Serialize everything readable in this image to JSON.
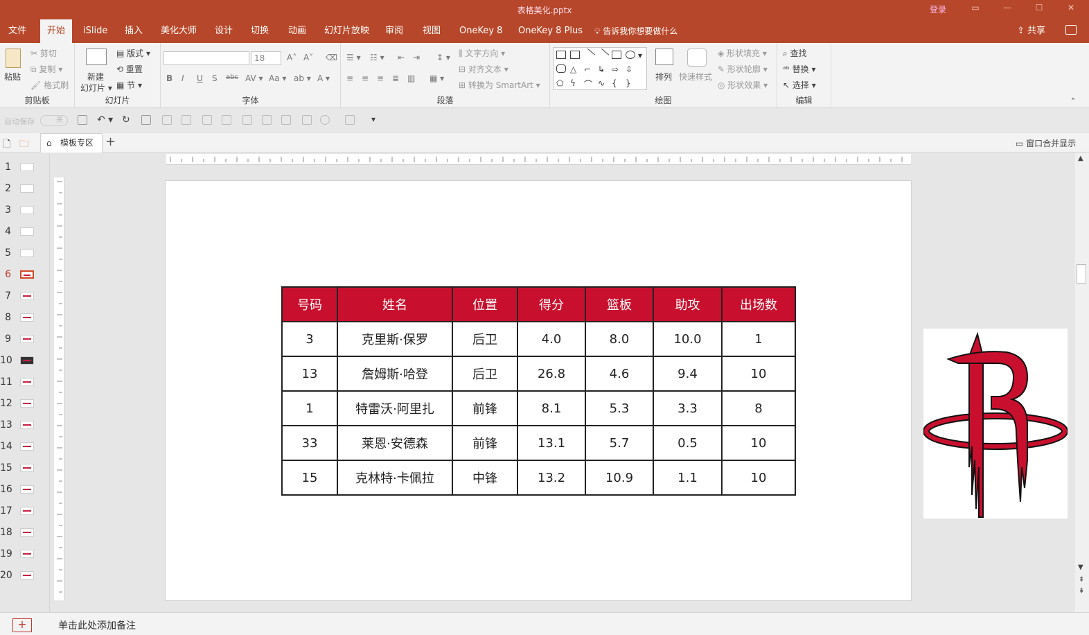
{
  "window": {
    "title": "表格美化.pptx",
    "login_label": "登录"
  },
  "menu": {
    "tabs": [
      "文件",
      "开始",
      "iSlide",
      "插入",
      "美化大师",
      "设计",
      "切换",
      "动画",
      "幻灯片放映",
      "审阅",
      "视图",
      "OneKey 8",
      "OneKey 8 Plus"
    ],
    "active_tab": "开始",
    "tell_me": "告诉我你想要做什么",
    "share": "共享"
  },
  "ribbon": {
    "clipboard": {
      "label": "剪贴板",
      "paste": "粘贴",
      "cut": "剪切",
      "copy": "复制",
      "format_painter": "格式刷"
    },
    "slides": {
      "label": "幻灯片",
      "new_slide_1": "新建",
      "new_slide_2": "幻灯片",
      "layout": "版式",
      "reset": "重置",
      "section": "节"
    },
    "font": {
      "label": "字体",
      "font_name": "",
      "font_size": "18"
    },
    "paragraph": {
      "label": "段落",
      "text_direction": "文字方向",
      "align_text": "对齐文本",
      "convert_smartart": "转换为 SmartArt"
    },
    "drawing": {
      "label": "绘图",
      "arrange": "排列",
      "quick_styles": "快速样式",
      "shape_fill": "形状填充",
      "shape_outline": "形状轮廓",
      "shape_effects": "形状效果"
    },
    "editing": {
      "label": "编辑",
      "find": "查找",
      "replace": "替换",
      "select": "选择"
    }
  },
  "qat": {
    "autosave": "自动保存",
    "toggle": "关"
  },
  "tabstrip": {
    "doc_tab": "模板专区",
    "merge_windows": "窗口合并显示"
  },
  "thumbnails": {
    "selected": 6,
    "numbers": [
      "1",
      "2",
      "3",
      "4",
      "5",
      "6",
      "7",
      "8",
      "9",
      "10",
      "11",
      "12",
      "13",
      "14",
      "15",
      "16",
      "17",
      "18",
      "19",
      "20"
    ]
  },
  "table": {
    "headers": [
      "号码",
      "姓名",
      "位置",
      "得分",
      "篮板",
      "助攻",
      "出场数"
    ],
    "rows": [
      [
        "3",
        "克里斯·保罗",
        "后卫",
        "4.0",
        "8.0",
        "10.0",
        "1"
      ],
      [
        "13",
        "詹姆斯·哈登",
        "后卫",
        "26.8",
        "4.6",
        "9.4",
        "10"
      ],
      [
        "1",
        "特雷沃·阿里扎",
        "前锋",
        "8.1",
        "5.3",
        "3.3",
        "8"
      ],
      [
        "33",
        "莱恩·安德森",
        "前锋",
        "13.1",
        "5.7",
        "0.5",
        "10"
      ],
      [
        "15",
        "克林特·卡佩拉",
        "中锋",
        "13.2",
        "10.9",
        "1.1",
        "10"
      ]
    ],
    "header_color": "#c8102e"
  },
  "notes": {
    "hint": "单击此处添加备注"
  },
  "colors": {
    "accent": "#b7472a",
    "table_header": "#c8102e"
  }
}
